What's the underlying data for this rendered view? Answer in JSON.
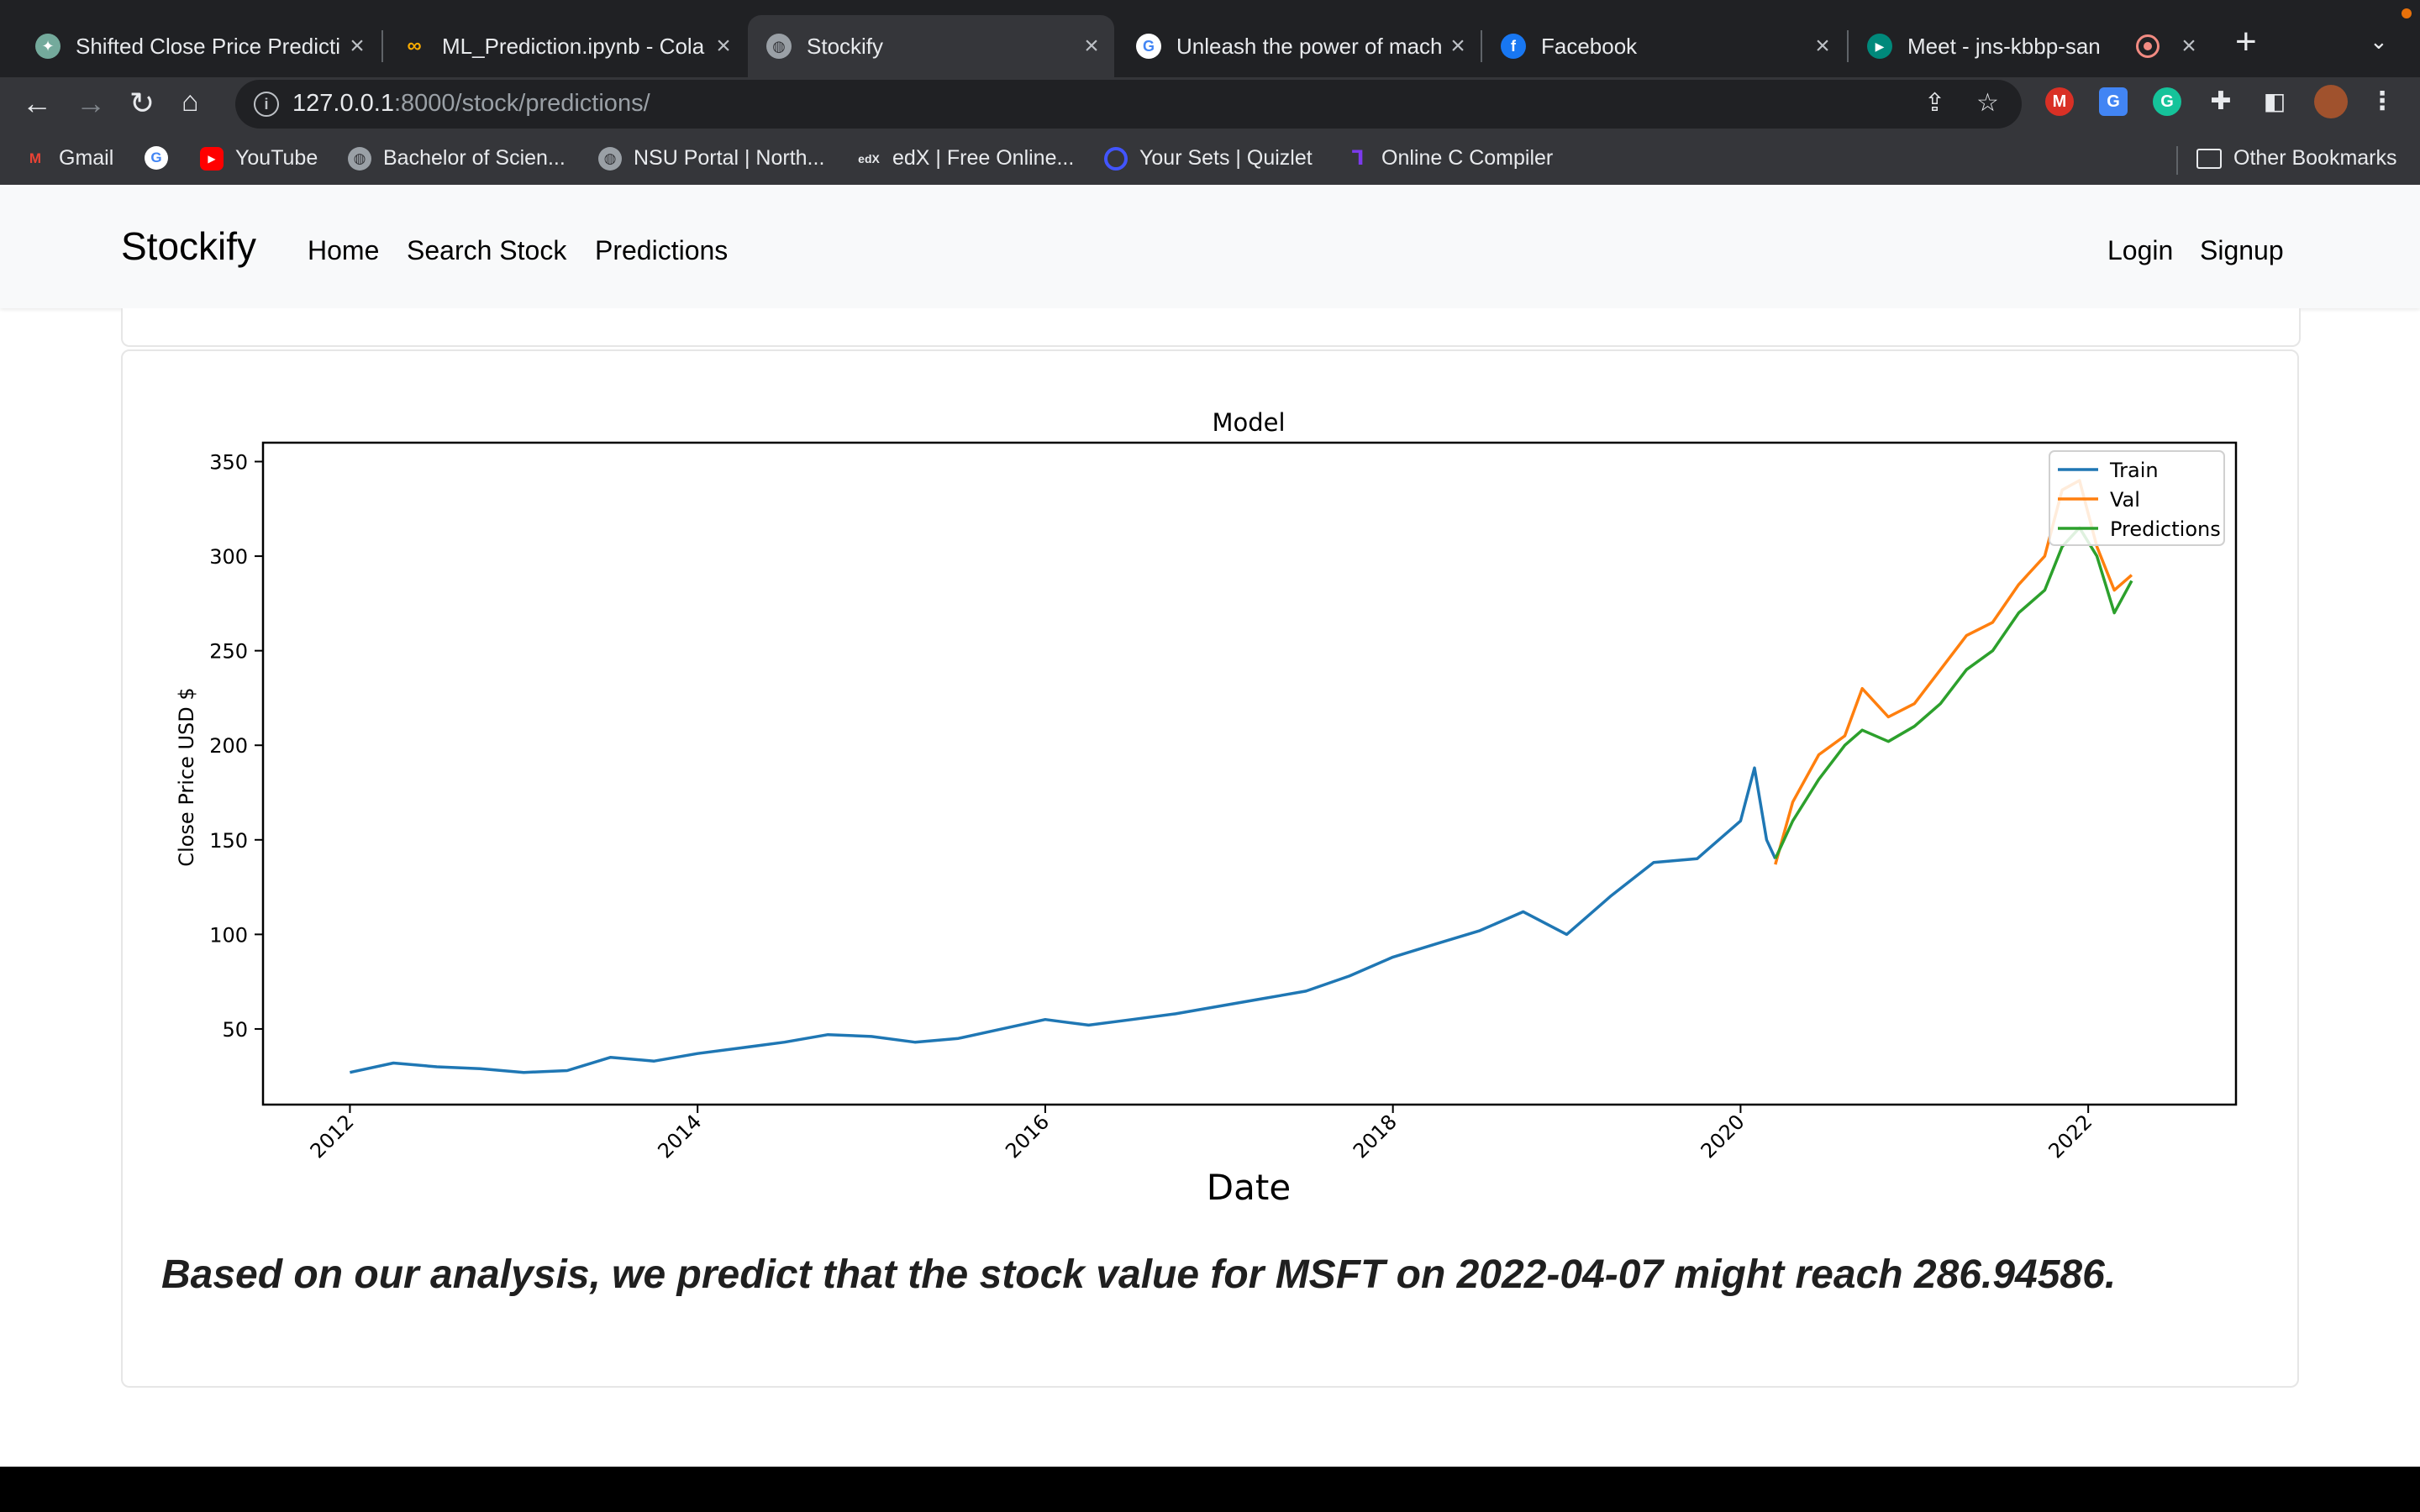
{
  "browser": {
    "tabs": [
      {
        "title": "Shifted Close Price Predicti",
        "icon": "chatgpt-icon",
        "color": "#74aa9c"
      },
      {
        "title": "ML_Prediction.ipynb - Cola",
        "icon": "colab-icon",
        "color": "#f9ab00"
      },
      {
        "title": "Stockify",
        "icon": "globe-icon",
        "color": "#9aa0a6",
        "active": true
      },
      {
        "title": "Unleash the power of mach",
        "icon": "google-icon",
        "color": "#4285f4"
      },
      {
        "title": "Facebook",
        "icon": "facebook-icon",
        "color": "#1877f2"
      },
      {
        "title": "Meet - jns-kbbp-san",
        "icon": "meet-icon",
        "color": "#00897b"
      }
    ],
    "url_host": "127.0.0.1",
    "url_rest": ":8000/stock/predictions/",
    "bookmarks": [
      {
        "label": "Gmail",
        "icon": "gmail-icon",
        "color": "#ea4335"
      },
      {
        "label": "",
        "icon": "google-icon",
        "color": "#4285f4"
      },
      {
        "label": "YouTube",
        "icon": "youtube-icon",
        "color": "#ff0000"
      },
      {
        "label": "Bachelor of Scien...",
        "icon": "globe-icon",
        "color": "#9aa0a6"
      },
      {
        "label": "NSU Portal | North...",
        "icon": "globe-icon",
        "color": "#9aa0a6"
      },
      {
        "label": "edX | Free Online...",
        "icon": "edx-icon",
        "color": "#02262b"
      },
      {
        "label": "Your Sets | Quizlet",
        "icon": "quizlet-icon",
        "color": "#4255ff"
      },
      {
        "label": "Online C Compiler",
        "icon": "compiler-icon",
        "color": "#7c3aed"
      }
    ],
    "other_bookmarks": "Other Bookmarks"
  },
  "navbar": {
    "brand": "Stockify",
    "links": [
      "Home",
      "Search Stock",
      "Predictions"
    ],
    "auth": [
      "Login",
      "Signup"
    ]
  },
  "chart_data": {
    "type": "line",
    "title": "Model",
    "xlabel": "Date",
    "ylabel": "Close Price USD $",
    "xlim": [
      2011.5,
      2022.85
    ],
    "ylim": [
      10,
      360
    ],
    "x_ticks": [
      "2012",
      "2014",
      "2016",
      "2018",
      "2020",
      "2022"
    ],
    "y_ticks": [
      50,
      100,
      150,
      200,
      250,
      300,
      350
    ],
    "legend_position": "top-right",
    "series": [
      {
        "name": "Train",
        "color": "#1f77b4",
        "x": [
          2012.0,
          2012.25,
          2012.5,
          2012.75,
          2013.0,
          2013.25,
          2013.5,
          2013.75,
          2014.0,
          2014.25,
          2014.5,
          2014.75,
          2015.0,
          2015.25,
          2015.5,
          2015.75,
          2016.0,
          2016.25,
          2016.5,
          2016.75,
          2017.0,
          2017.25,
          2017.5,
          2017.75,
          2018.0,
          2018.25,
          2018.5,
          2018.75,
          2019.0,
          2019.25,
          2019.5,
          2019.75,
          2020.0,
          2020.08,
          2020.15,
          2020.2
        ],
        "values": [
          27,
          32,
          30,
          29,
          27,
          28,
          35,
          33,
          37,
          40,
          43,
          47,
          46,
          43,
          45,
          50,
          55,
          52,
          55,
          58,
          62,
          66,
          70,
          78,
          88,
          95,
          102,
          112,
          100,
          120,
          138,
          140,
          160,
          188,
          150,
          140
        ]
      },
      {
        "name": "Val",
        "color": "#ff7f0e",
        "x": [
          2020.2,
          2020.3,
          2020.45,
          2020.6,
          2020.7,
          2020.85,
          2021.0,
          2021.15,
          2021.3,
          2021.45,
          2021.6,
          2021.75,
          2021.85,
          2021.95,
          2022.05,
          2022.15,
          2022.25
        ],
        "values": [
          137,
          170,
          195,
          205,
          230,
          215,
          222,
          240,
          258,
          265,
          285,
          300,
          335,
          340,
          305,
          282,
          290
        ]
      },
      {
        "name": "Predictions",
        "color": "#2ca02c",
        "x": [
          2020.2,
          2020.3,
          2020.45,
          2020.6,
          2020.7,
          2020.85,
          2021.0,
          2021.15,
          2021.3,
          2021.45,
          2021.6,
          2021.75,
          2021.85,
          2021.95,
          2022.05,
          2022.15,
          2022.25
        ],
        "values": [
          140,
          160,
          182,
          200,
          208,
          202,
          210,
          222,
          240,
          250,
          270,
          282,
          305,
          315,
          300,
          270,
          287
        ]
      }
    ]
  },
  "prediction_text": "Based on our analysis, we predict that the stock value for MSFT on 2022-04-07 might reach 286.94586."
}
